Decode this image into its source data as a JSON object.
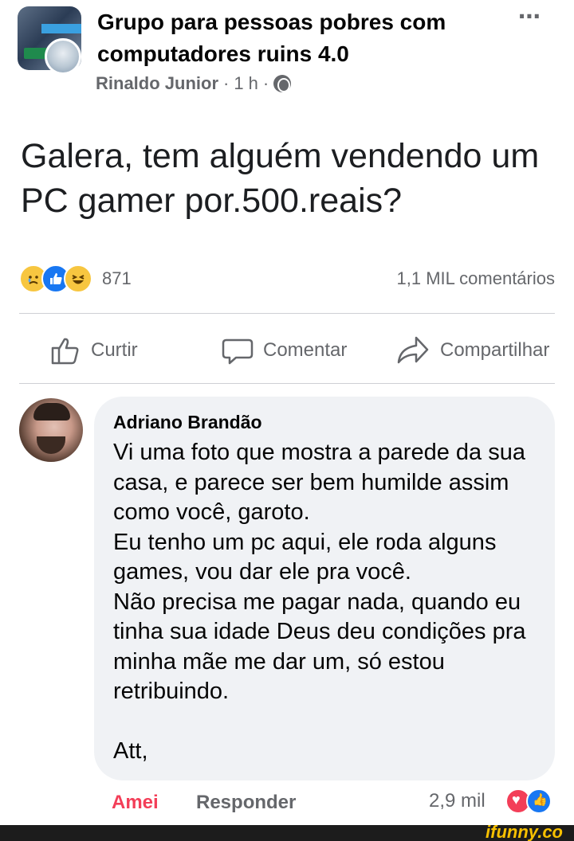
{
  "post": {
    "group_name": "Grupo para pessoas pobres com computadores ruins 4.0",
    "author": "Rinaldo Junior",
    "separator": "·",
    "time": "1 h",
    "separator2": "·",
    "text": "Galera, tem alguém vendendo um PC gamer por.500.reais?",
    "more_icon": "⋯"
  },
  "stats": {
    "reaction_icons": [
      "sad-icon",
      "like-icon",
      "haha-icon"
    ],
    "reaction_count": "871",
    "comments": "1,1 MIL comentários"
  },
  "actions": {
    "like": "Curtir",
    "comment": "Comentar",
    "share": "Compartilhar"
  },
  "comment": {
    "name": "Adriano Brandão",
    "body": "Vi uma foto que mostra a parede da sua casa, e parece ser bem humilde assim como você, garoto.\nEu tenho um pc aqui, ele roda alguns games, vou dar ele pra você.\nNão precisa me pagar nada, quando eu tinha sua idade Deus deu condições pra minha mãe me dar um, só estou retribuindo.\n\nAtt,",
    "reaction_label": "Amei",
    "reply_label": "Responder",
    "reaction_count": "2,9 mil",
    "reaction_icons": [
      "love-icon",
      "like-icon"
    ]
  },
  "watermark": "ifunny.co",
  "colors": {
    "love": "#f33e58",
    "like": "#1877f2",
    "muted": "#65676b",
    "bubble": "#f0f2f5"
  }
}
